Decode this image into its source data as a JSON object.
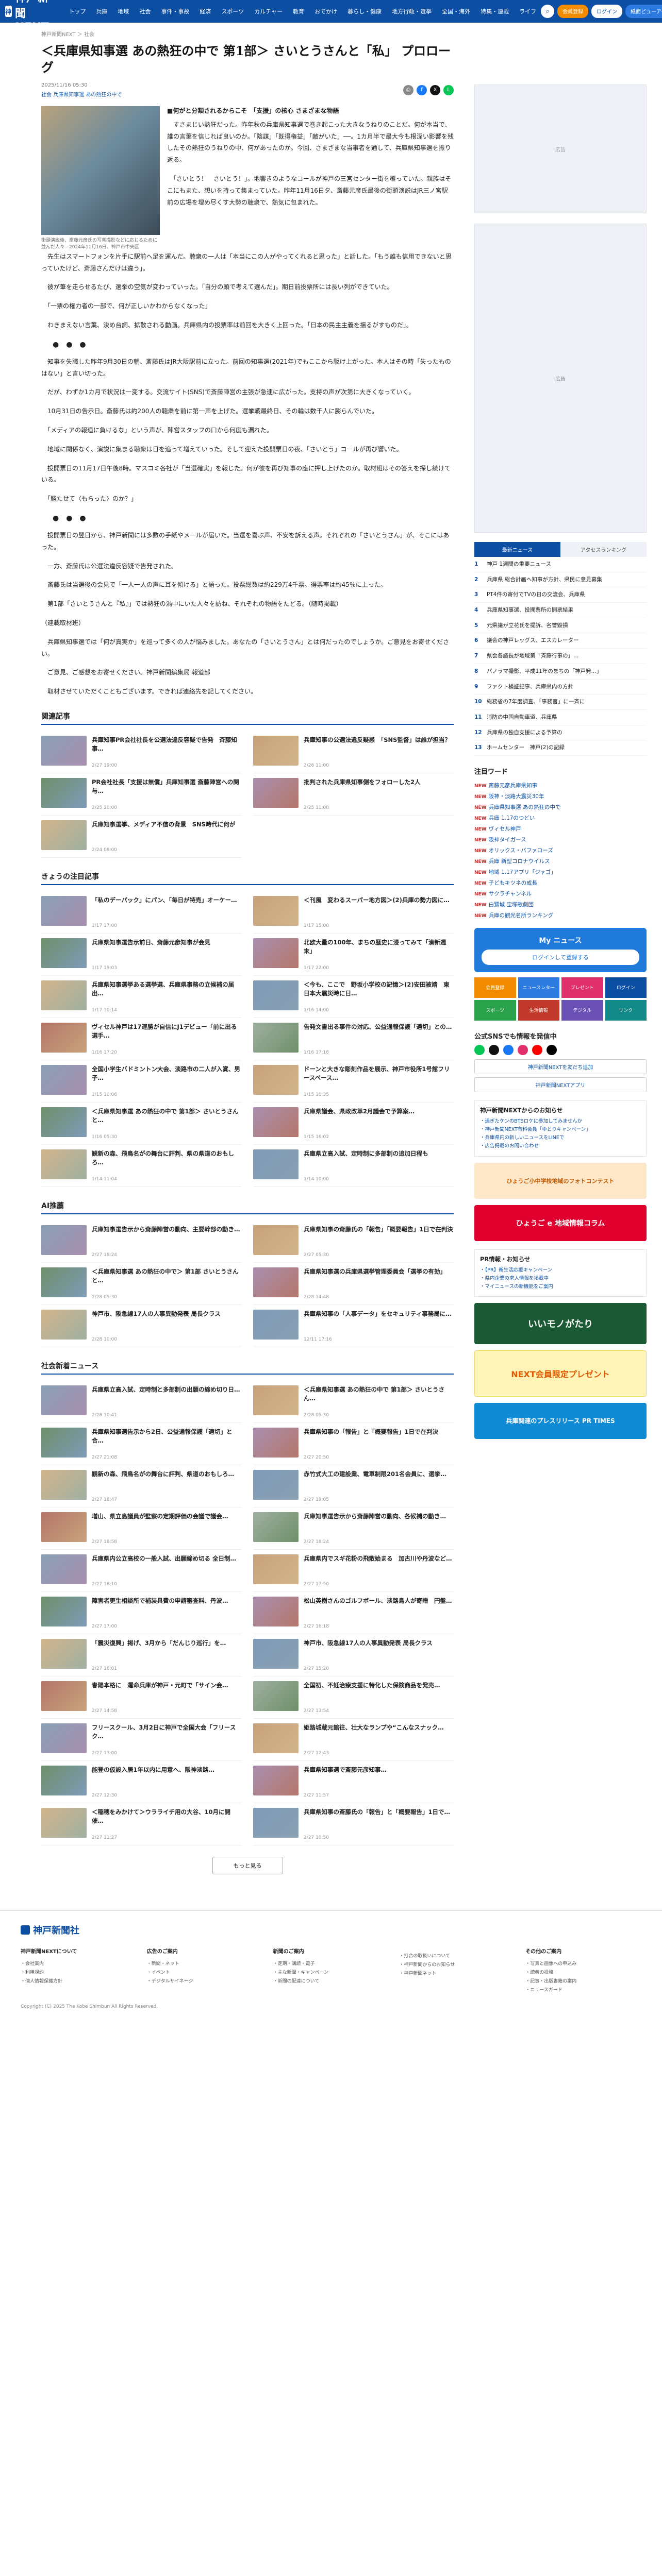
{
  "header": {
    "logo_text": "神戸新聞NEXT",
    "nav": [
      "トップ",
      "兵庫",
      "地域",
      "社会",
      "事件・事故",
      "経済",
      "スポーツ",
      "カルチャー",
      "教育",
      "おでかけ",
      "暮らし・健康",
      "地方行政・選挙",
      "全国・海外",
      "特集・連載",
      "ライフ"
    ],
    "btn_member": "会員登録",
    "btn_login": "ログイン",
    "btn_paper": "紙面ビューアー"
  },
  "article": {
    "breadcrumb": "神戸新聞NEXT ＞ 社会",
    "title": "＜兵庫県知事選 あの熱狂の中で 第1部＞ さいとうさんと「私」 プロローグ",
    "date": "2025/11/16 05:30",
    "tags": "社会  兵庫県知事選 あの熱狂の中で",
    "photo_caption": "街頭演説後、斎藤元彦氏の写真撮影などに応じるために並んだ人々＝2024年11月16日、神戸市中央区",
    "subhead": "■何がと分類されるからこそ　「支援」の核心 さまざまな物語",
    "paragraphs": [
      "　すさまじい熱狂だった。昨年秋の兵庫県知事選で巻き起こった大きなうねりのことだ。何が本当で、誰の言葉を信じれば良いのか。「陰謀」「既得権益」「敵がいた」──。1カ月半で最大今も根深い影響を残したその熱狂のうねりの中、何があったのか。今回、さまざまな当事者を通して、兵庫県知事選を振り返る。",
      "　「さいとう！　さいとう！」。地響きのようなコールが神戸の三宮センター街を覆っていた。親族はそこにもまた、想いを持って集まっていた。昨年11月16日夕、斎藤元彦氏最後の街頭演説はJR三ノ宮駅前の広場を埋め尽くす大勢の聴衆で、熱気に包まれた。",
      "　先生はスマートフォンを片手に駅前へ足を運んだ。聴衆の一人は「本当にこの人がやってくれると思った」と話した。「もう誰も信用できないと思っていたけど、斎藤さんだけは違う」。",
      "　彼が筆を走らせるたび、選挙の空気が変わっていった。「自分の頭で考えて選んだ」。期日前投票所には長い列ができていた。",
      "　「一票の権力者の一部で、何が正しいかわからなくなった」",
      "　わきまえない言葉、決め台詞、拡散される動画。兵庫県内の投票率は前回を大きく上回った。「日本の民主主義を揺るがすものだ」。",
      "　知事を失職した昨年9月30日の朝、斎藤氏はJR大阪駅前に立った。前回の知事選(2021年)でもここから駆け上がった。本人はその時「失ったものはない」と言い切った。",
      "　だが、わずか1カ月で状況は一変する。交流サイト(SNS)で斎藤陣営の主張が急速に広がった。支持の声が次第に大きくなっていく。",
      "　10月31日の告示日。斎藤氏は約200人の聴衆を前に第一声を上げた。選挙戦最終日、その輪は数千人に膨らんでいた。",
      "　「メディアの報道に負けるな」という声が、陣営スタッフの口から何度も漏れた。",
      "　地域に関係なく、演説に集まる聴衆は日を追って増えていった。そして迎えた投開票日の夜、「さいとう」コールが再び響いた。",
      "　投開票日の11月17日午後8時。マスコミ各社が「当選確実」を報じた。何が彼を再び知事の座に押し上げたのか。取材班はその答えを探し続けている。",
      "　「勝たせて〈もらった〉のか？」",
      "　投開票日の翌日から、神戸新聞には多数の手紙やメールが届いた。当選を喜ぶ声、不安を訴える声。それぞれの「さいとうさん」が、そこにはあった。",
      "　一方、斎藤氏は公選法違反容疑で告発された。",
      "　斎藤氏は当選後の会見で「一人一人の声に耳を傾ける」と語った。投票総数は約229万4千票。得票率は約45％に上った。",
      "　第1部「さいとうさんと『私』」では熱狂の渦中にいた人々を訪ね、それぞれの物語をたどる。（随時掲載）",
      "（連載取材班）",
      "　兵庫県知事選では「何が真実か」を巡って多くの人が悩みました。あなたの「さいとうさん」とは何だったのでしょうか。ご意見をお寄せください。",
      "　ご意見、ご感想をお寄せください。神戸新聞編集局 報道部",
      "　取材させていただくこともございます。できれば連絡先を記してください。"
    ]
  },
  "sections": {
    "related": {
      "title": "関連記事",
      "items": [
        {
          "title": "兵庫知事PR会社社長を公選法違反容疑で告発　斉藤知事…",
          "time": "2/27 19:00"
        },
        {
          "title": "兵庫知事の公選法違反疑惑　「SNS監督」は誰が担当？",
          "time": "2/26 11:00"
        },
        {
          "title": "PR会社社長「支援は無償」兵庫知事選 斎藤陣営への関与…",
          "time": "2/25 20:00"
        },
        {
          "title": "批判された兵庫県知事側をフォローした2人",
          "time": "2/25 11:00"
        },
        {
          "title": "兵庫知事選挙、メディア不信の背景　SNS時代に何が",
          "time": "2/24 08:00"
        }
      ]
    },
    "today": {
      "title": "きょうの注目記事",
      "items": [
        {
          "title": "「私のデーパック」にパン、「毎日が特売」オーケー…",
          "time": "1/17 17:00"
        },
        {
          "title": "＜刊風　変わるスーパー地方図＞(2)兵庫の勢力図に…",
          "time": "1/17 15:00"
        },
        {
          "title": "兵庫県知事選告示前日、斎藤元彦知事が会見",
          "time": "1/17 19:03"
        },
        {
          "title": "北欧大量の100年、まちの歴史に浸ってみて「湊新週末」",
          "time": "1/17 22:00"
        },
        {
          "title": "兵庫県知事選挙ある選挙選、兵庫県事務の立候補の届出…",
          "time": "1/17 10:14"
        },
        {
          "title": "＜今も、ここで　野坂小学校の記憶＞(2)安田被靖　東日本大震災時に日…",
          "time": "1/16 14:00"
        },
        {
          "title": "ヴィセル神戸は17連勝が自信にJ1デビュー「前に出る選手…",
          "time": "1/16 17:20"
        },
        {
          "title": "告発文書出る事件の対応、公益通報保護「適切」との…",
          "time": "1/16 17:18"
        },
        {
          "title": "全国小学生バドミントン大会、淡路市の二人が入賞、男子…",
          "time": "1/15 10:06"
        },
        {
          "title": "ドーンと大きな彫刻作品を展示、神戸市役所1号館フリースペース…",
          "time": "1/15 10:35"
        },
        {
          "title": "＜兵庫県知事選 あの熱狂の中で 第1部＞ さいとうさんと…",
          "time": "1/16 05:30"
        },
        {
          "title": "兵庫県議会、県政改革2月議会で予算案…",
          "time": "1/15 16:02"
        },
        {
          "title": "観新の森、飛鳥名がの舞台に評判、県の県道のおもしろ…",
          "time": "1/14 11:04"
        },
        {
          "title": "兵庫県立高入試、定時制に多部制の追加日程も",
          "time": "1/14 10:00"
        }
      ]
    },
    "ai": {
      "title": "AI推薦",
      "items": [
        {
          "title": "兵庫知事選告示から斎藤陣営の動向、主要幹部の動き…",
          "time": "2/27 18:24"
        },
        {
          "title": "兵庫県知事の斎藤氏の「報告」「概要報告」1日で在判決",
          "time": "2/27 05:30"
        },
        {
          "title": "＜兵庫県知事選 あの熱狂の中で＞ 第1部 さいとうさんと…",
          "time": "2/28 05:30"
        },
        {
          "title": "兵庫県知事選の兵庫県選挙管理委員会「選挙の有効」",
          "time": "2/28 14:48"
        },
        {
          "title": "神戸市、阪急線17人の人事異動発表 局長クラス",
          "time": "2/28 10:00"
        },
        {
          "title": "兵庫県知事の「人事データ」をセキュリティ事務局に…",
          "time": "12/11 17:16"
        }
      ]
    },
    "society": {
      "title": "社会新着ニュース",
      "items": [
        {
          "title": "兵庫県立高入試、定時制と多部制の出願の締め切り日…",
          "time": "2/28 10:41"
        },
        {
          "title": "＜兵庫県知事選 あの熱狂の中で 第1部＞ さいとうさん…",
          "time": "2/28 05:30"
        },
        {
          "title": "兵庫県知事選告示から2日、公益通報保護「適切」と合…",
          "time": "2/27 21:08"
        },
        {
          "title": "兵庫県知事の「報告」と「概要報告」1日で在判決",
          "time": "2/27 20:50"
        },
        {
          "title": "観新の森、飛鳥名がの舞台に評判、県道のおもしろ…",
          "time": "2/27 18:47"
        },
        {
          "title": "赤竹式大工の建設業、電車制限201名会員に、選挙…",
          "time": "2/27 19:05"
        },
        {
          "title": "増山、県立島議員が監察の定期評価の会議で議会…",
          "time": "2/27 18:58"
        },
        {
          "title": "兵庫知事選告示から斎藤陣営の動向、各候補の動き…",
          "time": "2/27 18:24"
        },
        {
          "title": "兵庫県内公立高校の一般入試、出願締め切る 全日制…",
          "time": "2/27 18:10"
        },
        {
          "title": "兵庫県内でスギ花粉の飛散始まる　加古川や丹波など…",
          "time": "2/27 17:50"
        },
        {
          "title": "障害者更生相談所で補装具費の申請審査料、丹波…",
          "time": "2/27 17:00"
        },
        {
          "title": "松山英樹さんのゴルフボール、淡路島人が寄贈　円盤…",
          "time": "2/27 16:18"
        },
        {
          "title": "「震災復興」掲げ、3月から「だんじり巡行」を…",
          "time": "2/27 16:01"
        },
        {
          "title": "神戸市、阪急線17人の人事異動発表 局長クラス",
          "time": "2/27 15:20"
        },
        {
          "title": "春陽本格に　運命兵庫が神戸・元町で「サイン会…",
          "time": "2/27 14:58"
        },
        {
          "title": "全国初、不妊治療支援に特化した保険商品を発売…",
          "time": "2/27 13:54"
        },
        {
          "title": "フリースクール、3月2日に神戸で全国大会「フリースク…",
          "time": "2/27 13:00"
        },
        {
          "title": "姫路城蔵元館往、壮大なランプや“こんなスナック…",
          "time": "2/27 12:43"
        },
        {
          "title": "能登の仮設入居1年以内に用意へ、阪神淡路…",
          "time": "2/27 12:30"
        },
        {
          "title": "兵庫県知事選で斎藤元彦知事…",
          "time": "2/27 11:57"
        },
        {
          "title": "＜稲穂をみかけて＞ウラライチ用の大谷、10月に開催…",
          "time": "2/27 11:27"
        },
        {
          "title": "兵庫県知事の斎藤氏の「報告」と「概要報告」1日で…",
          "time": "2/27 10:50"
        }
      ]
    },
    "more_label": "もっと見る"
  },
  "sidebar": {
    "ad_label": "広告",
    "tab_news": "最新ニュース",
    "tab_access": "アクセスランキング",
    "ranking": [
      "神戸 1週間の重要ニュース",
      "兵庫県 総合計画へ知事が方針、県民に意見募集",
      "PT4件の寄付でTVの日の交流会、兵庫県",
      "兵庫県知事選、投開票所の開票結果",
      "元県議が立花氏を提訴、名誉毀損",
      "議会の神戸レッグス、エスカレーター",
      "県会各議長が地域第「斉藤行事の」…",
      "パノラマ撮影、平成11年のまちの「神戸発…」",
      "ファクト検証記事、兵庫県内の方針",
      "総務省の7年度調査、「事務官」に一斉に",
      "消防の中国自動車道、兵庫県",
      "兵庫県の独自支援による予算の",
      "ホームセンター　神戸(2)の記録"
    ],
    "attention_title": "注目ワード",
    "attention": [
      "斎藤元彦兵庫県知事",
      "阪神・淡路大震災30年",
      "兵庫県知事選 あの熱狂の中で",
      "兵庫 1.17のつどい",
      "ヴィセル神戸",
      "阪神タイガース",
      "オリックス・バファローズ",
      "兵庫 新型コロナウイルス",
      "地域 1.17アプリ「ジャゴ」",
      "子どもキツネの成長",
      "サクラチャンネル",
      "白鷺城 宝塚歌劇団",
      "兵庫の観光名所ランキング"
    ],
    "promo": {
      "title": "My ニュース",
      "button": "ログインして登録する"
    },
    "features": [
      "会員登録",
      "ニュースレター",
      "プレゼント",
      "ログイン",
      "スポーツ",
      "生活情報",
      "デジタル",
      "リンク"
    ],
    "sns_title": "公式SNSでも情報を発信中",
    "sns_btn1": "神戸新聞NEXTを友だち追加",
    "sns_btn2": "神戸新聞NEXTアプリ",
    "box1": {
      "title": "神戸新聞NEXTからのお知らせ",
      "lines": [
        "・過ぎたケンのBTSロケに参加してみませんか",
        "・神戸新聞NEXT有料会員「ゆとりキャンペーン」",
        "・兵庫県内の新しいニュースをLINEで",
        "・広告掲載のお問い合わせ"
      ]
    },
    "banner1": "ひょうご小中学校地域のフォトコンテスト",
    "banner2": "ひょうご e 地域情報コラム",
    "box2": {
      "title": "PR情報・お知らせ",
      "lines": [
        "・【PR】新生活応援キャンペーン",
        "・県内企業の求人情報を掲載中",
        "・マイニュースの新機能をご案内"
      ]
    },
    "banner3": "いいモノがたり",
    "banner4": "NEXT会員限定プレゼント",
    "banner5": "兵庫関連のプレスリリース PR TIMES"
  },
  "footer": {
    "logo": "神戸新聞社",
    "columns": [
      {
        "title": "神戸新聞NEXTについて",
        "links": [
          "・会社案内",
          "・利用規約",
          "・個人情報保護方針"
        ]
      },
      {
        "title": "広告のご案内",
        "links": [
          "・新聞・ネット",
          "・イベント",
          "・デジタルサイネージ"
        ]
      },
      {
        "title": "新聞のご案内",
        "links": [
          "・定期・購読・電子",
          "・主な新聞・キャンペーン",
          "・新聞の配達について"
        ]
      },
      {
        "title": "",
        "links": [
          "・打合の取扱いについて",
          "・神戸新聞からのお知らせ",
          "・神戸新聞ネット"
        ]
      },
      {
        "title": "その他のご案内",
        "links": [
          "・写真と画像への申込み",
          "・読者の投稿",
          "・記事・出版書籍の案内",
          "・ニュースガード"
        ]
      }
    ],
    "copyright": "Copyright (C) 2025 The Kobe Shimbun All Rights Reserved."
  },
  "colors": {
    "brand": "#0b4ea2",
    "accent": "#f28b00"
  }
}
